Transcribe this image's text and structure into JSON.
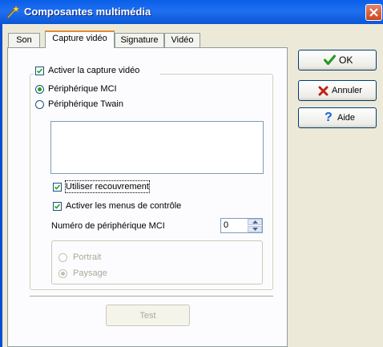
{
  "window": {
    "title": "Composantes multimédia"
  },
  "tabs": [
    {
      "label": "Son"
    },
    {
      "label": "Capture vidéo"
    },
    {
      "label": "Signature"
    },
    {
      "label": "Vidéo"
    }
  ],
  "capture": {
    "enable_label": "Activer la capture vidéo",
    "enable_checked": true,
    "device_mci_label": "Périphérique MCI",
    "device_mci_selected": true,
    "device_twain_label": "Périphérique Twain",
    "use_overlay_label": "Utiliser recouvrement",
    "use_overlay_checked": true,
    "control_menus_label": "Activer les menus de contrôle",
    "control_menus_checked": true,
    "device_number_label": "Numéro de périphérique MCI",
    "device_number_value": "0"
  },
  "orientation": {
    "portrait_label": "Portrait",
    "landscape_label": "Paysage",
    "selected": "Paysage"
  },
  "test_button": {
    "label": "Test"
  },
  "actions": {
    "ok_label": "OK",
    "cancel_label": "Annuler",
    "help_label": "Aide"
  }
}
